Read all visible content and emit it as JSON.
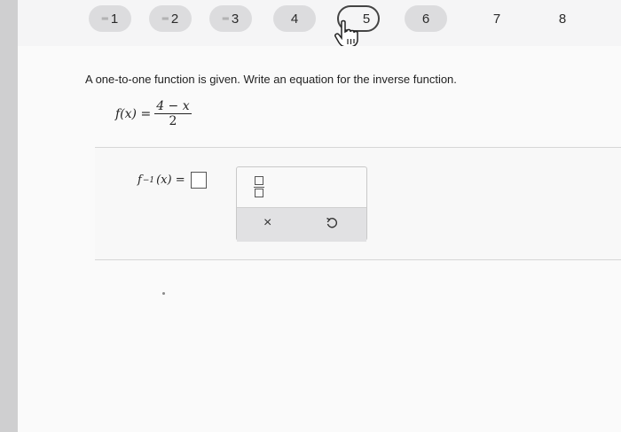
{
  "question_nav": {
    "items": [
      {
        "label": "1",
        "status": "answered"
      },
      {
        "label": "2",
        "status": "answered"
      },
      {
        "label": "3",
        "status": "answered"
      },
      {
        "label": "4",
        "status": "unanswered"
      },
      {
        "label": "5",
        "status": "current"
      },
      {
        "label": "6",
        "status": "unanswered"
      },
      {
        "label": "7",
        "status": "plain"
      },
      {
        "label": "8",
        "status": "plain"
      }
    ],
    "answered_mark": "═"
  },
  "question": {
    "prompt": "A one-to-one function is given. Write an equation for the inverse function.",
    "function_lhs": "f(x) =",
    "numerator": "4 − x",
    "denominator": "2",
    "inverse_lhs_f": "f",
    "inverse_lhs_exp": "−1",
    "inverse_lhs_rest": "(x) ="
  },
  "toolbox": {
    "clear_symbol": "×",
    "fraction_tool": "fraction-template",
    "undo_tool": "undo"
  },
  "colors": {
    "pill_bg": "#dcdcde",
    "panel_bg": "#fafafa",
    "toolrow_bg": "#e1e1e3"
  }
}
